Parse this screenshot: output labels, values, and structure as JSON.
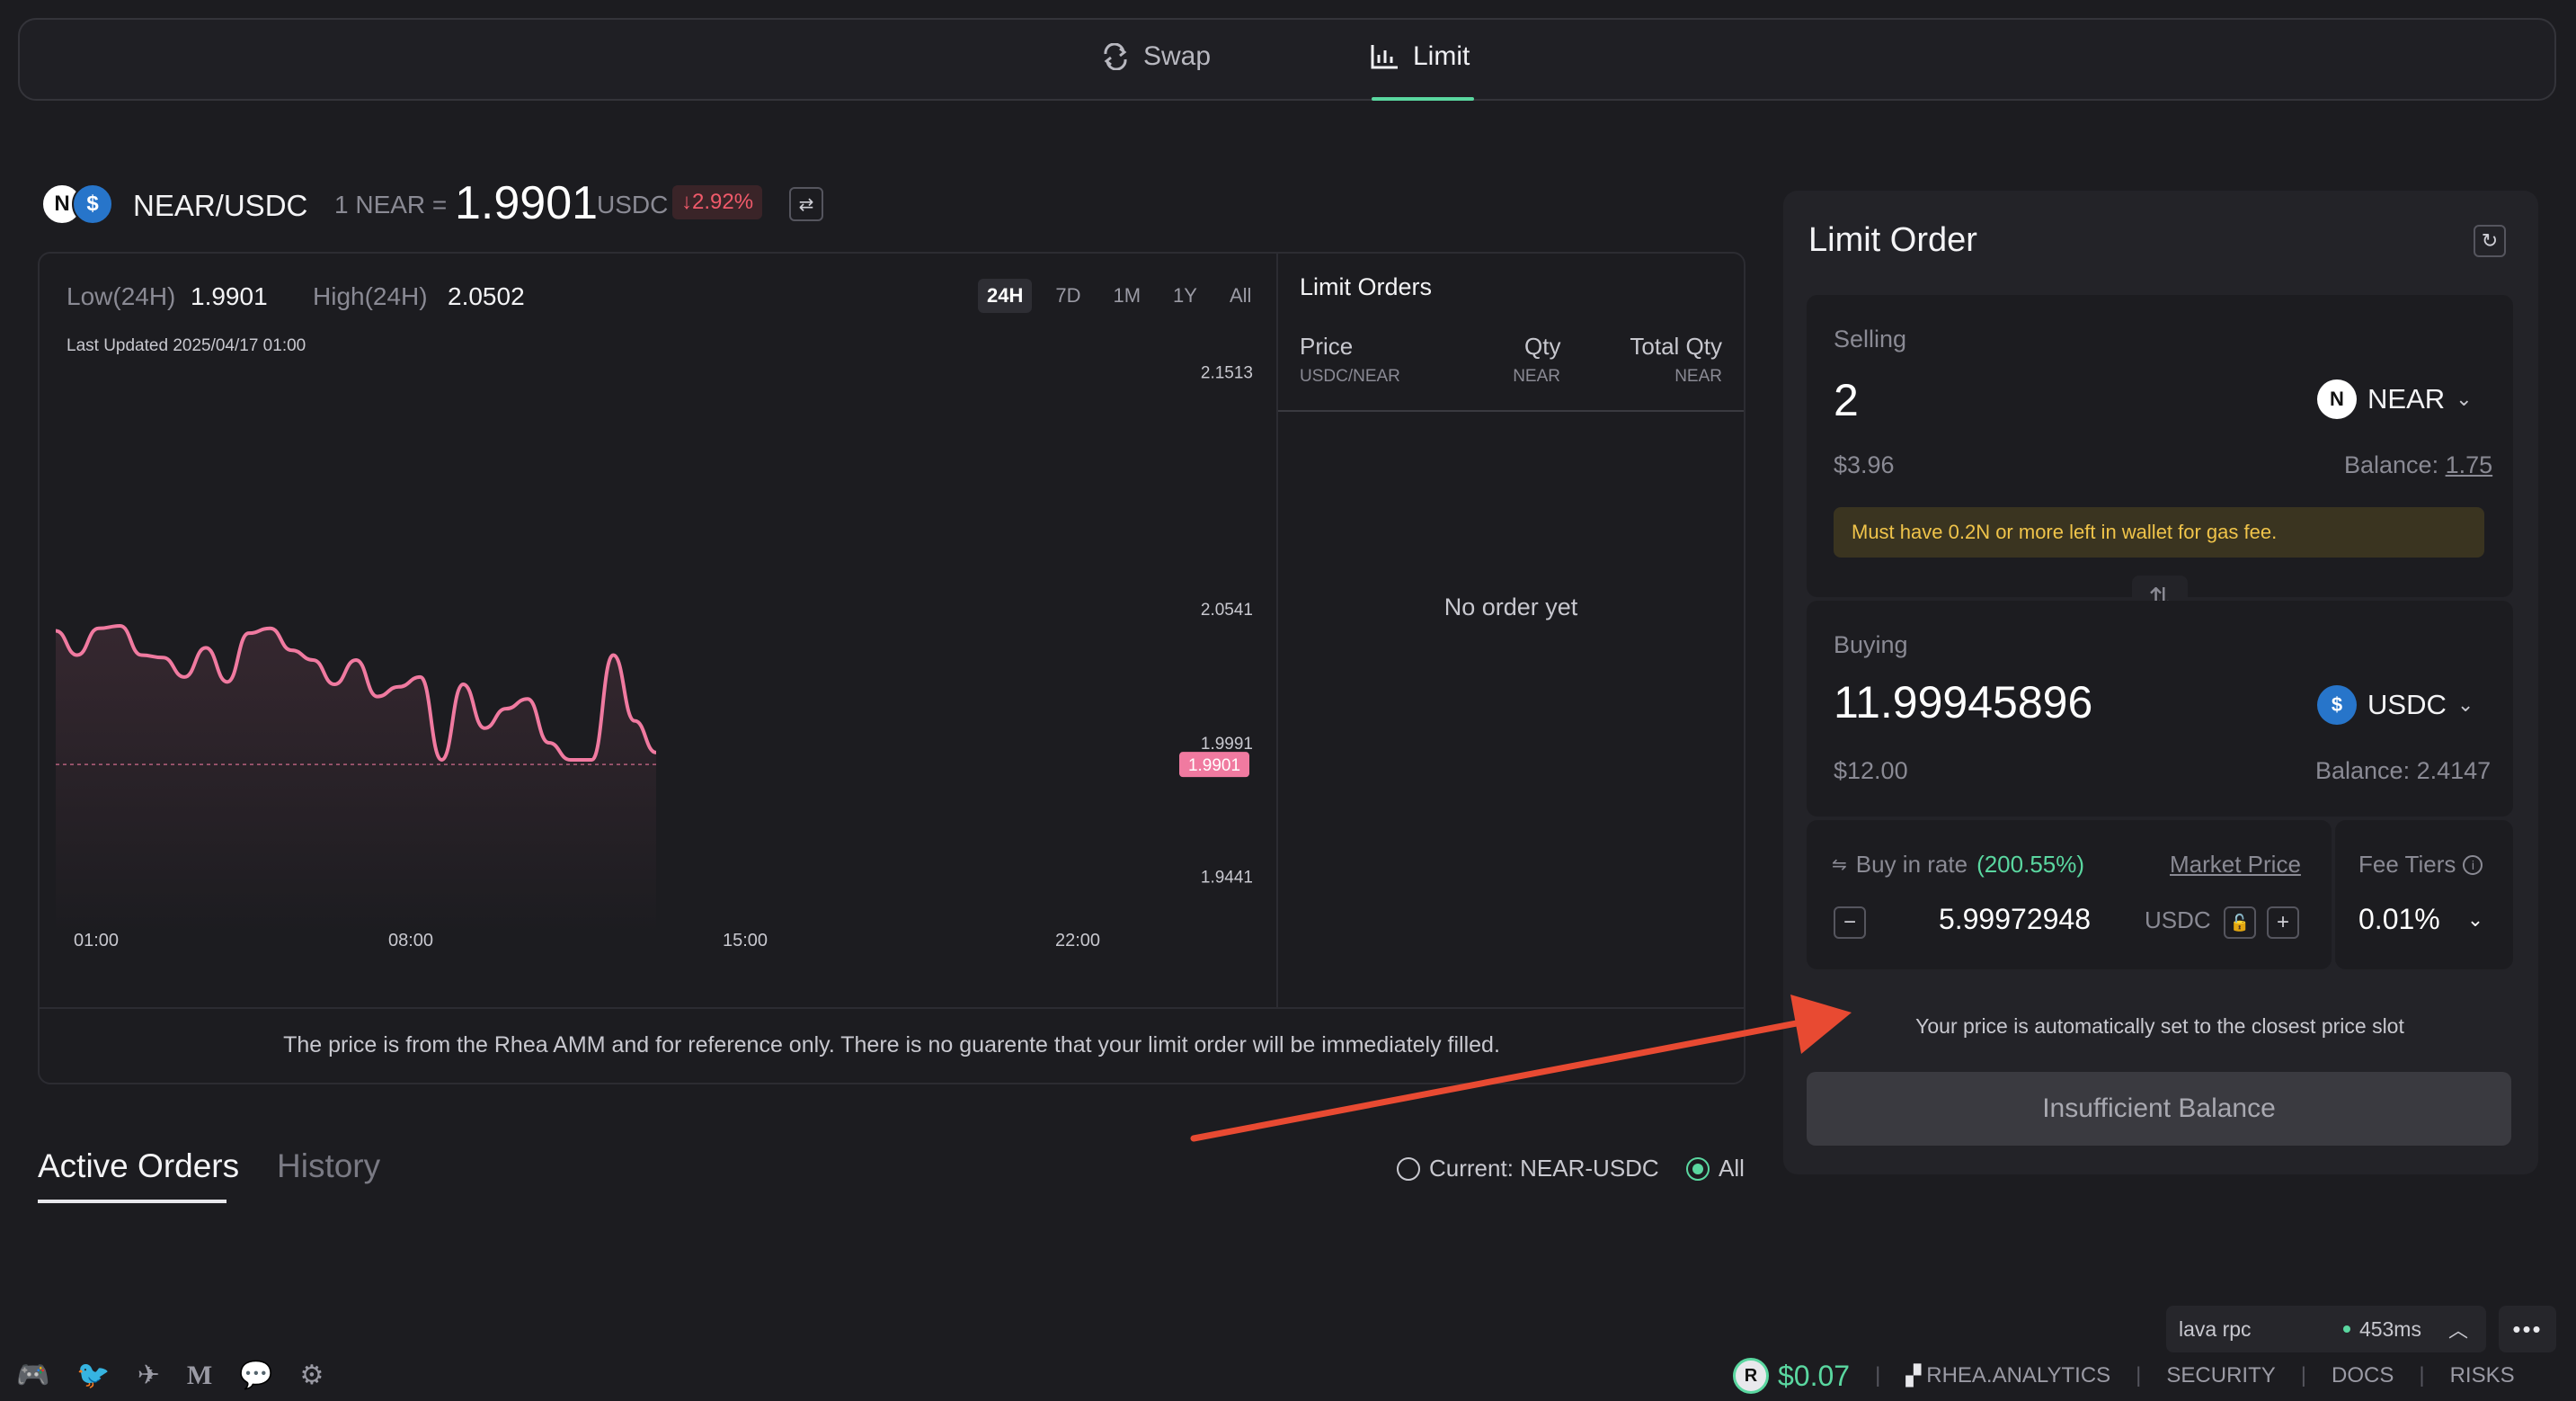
{
  "topbar": {
    "tabs": [
      {
        "label": "Swap",
        "icon": "swap-icon"
      },
      {
        "label": "Limit",
        "icon": "chart-icon",
        "active": true
      }
    ]
  },
  "pair": {
    "name": "NEAR/USDC",
    "rate_prefix": "1 NEAR =",
    "price": "1.9901",
    "quote": "USDC",
    "change": "↓2.92%",
    "change_color": "#f05a6a"
  },
  "chart_panel": {
    "low_label": "Low(24H)",
    "low_value": "1.9901",
    "high_label": "High(24H)",
    "high_value": "2.0502",
    "last_updated_label": "Last Updated",
    "last_updated_value": "2025/04/17 01:00",
    "timeframes": [
      "24H",
      "7D",
      "1M",
      "1Y",
      "All"
    ],
    "active_timeframe": "24H",
    "disclaimer": "The price is from the Rhea AMM and for reference only. There is no guarente that your limit order will be immediately filled."
  },
  "chart_data": {
    "type": "line",
    "x_ticks": [
      "01:00",
      "08:00",
      "15:00",
      "22:00"
    ],
    "y_ticks": [
      "2.1513",
      "2.0541",
      "1.9991",
      "1.9441"
    ],
    "current_label": "1.9901",
    "series": [
      {
        "values": [
          2.045,
          2.035,
          2.046,
          2.047,
          2.035,
          2.034,
          2.026,
          2.038,
          2.024,
          2.044,
          2.046,
          2.037,
          2.033,
          2.023,
          2.033,
          2.018,
          2.022,
          2.026,
          1.992,
          2.023,
          2.005,
          2.013,
          2.017,
          1.999,
          1.992,
          1.992,
          2.035,
          2.008,
          1.995
        ]
      }
    ],
    "ylim": [
      1.92,
      2.16
    ],
    "line_color": "#f07aa0",
    "grid": false
  },
  "limit_orders": {
    "title": "Limit Orders",
    "col_price": "Price",
    "col_price_unit": "USDC/NEAR",
    "col_qty": "Qty",
    "col_qty_unit": "NEAR",
    "col_total": "Total Qty",
    "col_total_unit": "NEAR",
    "empty": "No order yet"
  },
  "order_tabs": {
    "active": "Active Orders",
    "history": "History",
    "filter_current": "Current: NEAR-USDC",
    "filter_all": "All"
  },
  "limit_card": {
    "title": "Limit Order",
    "selling_label": "Selling",
    "selling_amount": "2",
    "selling_token": "NEAR",
    "selling_usd": "$3.96",
    "selling_balance_label": "Balance:",
    "selling_balance": "1.75",
    "gas_warning": "Must have 0.2N or more left in wallet for gas fee.",
    "buying_label": "Buying",
    "buying_amount": "11.99945896",
    "buying_token": "USDC",
    "buying_usd": "$12.00",
    "buying_balance": "Balance: 2.4147",
    "rate_label": "Buy in rate",
    "rate_pct": "(200.55%)",
    "market_price": "Market Price",
    "rate_value": "5.99972948",
    "rate_unit": "USDC",
    "fee_label": "Fee Tiers",
    "fee_value": "0.01%",
    "price_note": "Your price is automatically set to the closest price slot",
    "cta": "Insufficient Balance"
  },
  "status": {
    "rpc_name": "lava rpc",
    "rpc_latency": "453ms",
    "token_price": "$0.07",
    "links": [
      "RHEA.ANALYTICS",
      "SECURITY",
      "DOCS",
      "RISKS"
    ]
  },
  "colors": {
    "accent_green": "#5ad7a0",
    "annotation_arrow": "#e84a32"
  }
}
